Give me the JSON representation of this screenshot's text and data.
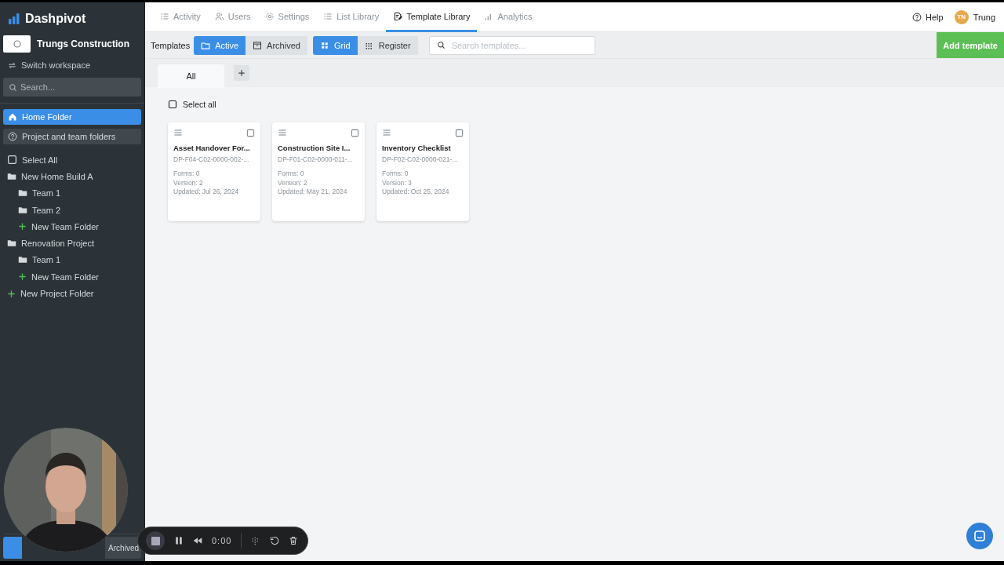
{
  "brand": {
    "name": "Dashpivot"
  },
  "workspace": {
    "name": "Trungs Construction",
    "switch_label": "Switch workspace"
  },
  "sidebar": {
    "search": {
      "placeholder": "Search..."
    },
    "nav": [
      {
        "label": "Home Folder",
        "selected": true
      },
      {
        "label": "Project and team folders",
        "selected": false
      }
    ],
    "tree": [
      {
        "kind": "checkbox",
        "label": "Select All",
        "checked": false
      },
      {
        "kind": "folder",
        "label": "New Home Build A",
        "children": [
          {
            "kind": "folder",
            "label": "Team 1"
          },
          {
            "kind": "folder",
            "label": "Team 2"
          },
          {
            "kind": "add",
            "label": "New Team Folder"
          }
        ]
      },
      {
        "kind": "folder",
        "label": "Renovation Project",
        "children": [
          {
            "kind": "folder",
            "label": "Team 1"
          },
          {
            "kind": "add",
            "label": "New Team Folder"
          }
        ]
      },
      {
        "kind": "add",
        "label": "New Project Folder"
      }
    ],
    "footer_button": {
      "label": "Archived"
    }
  },
  "top_nav": {
    "tabs": [
      {
        "label": "Activity",
        "selected": false
      },
      {
        "label": "Users",
        "selected": false
      },
      {
        "label": "Settings",
        "selected": false
      },
      {
        "label": "List Library",
        "selected": false
      },
      {
        "label": "Template Library",
        "selected": true
      },
      {
        "label": "Analytics",
        "selected": false
      }
    ],
    "help": "Help",
    "user": {
      "initials": "TN",
      "name": "Trung"
    }
  },
  "toolbar": {
    "label": "Templates",
    "status": [
      {
        "label": "Active",
        "selected": true
      },
      {
        "label": "Archived",
        "selected": false
      }
    ],
    "view": [
      {
        "label": "Grid",
        "selected": true
      },
      {
        "label": "Register",
        "selected": false
      }
    ],
    "search": {
      "placeholder": "Search templates..."
    },
    "add_button": "Add template"
  },
  "tabs": [
    {
      "label": "All",
      "selected": true
    }
  ],
  "select_all": {
    "label": "Select all",
    "checked": false
  },
  "cards": [
    {
      "title": "Asset Handover For...",
      "code": "DP-F04-C02-0000-002-...",
      "forms": "Forms: 0",
      "version": "Version: 2",
      "updated": "Updated: Jul 26, 2024",
      "checked": false
    },
    {
      "title": "Construction Site I...",
      "code": "DP-F01-C02-0000-011-...",
      "forms": "Forms: 0",
      "version": "Version: 2",
      "updated": "Updated: May 21, 2024",
      "checked": false
    },
    {
      "title": "Inventory Checklist",
      "code": "DP-F02-C02-0000-021-...",
      "forms": "Forms: 0",
      "version": "Version: 3",
      "updated": "Updated: Oct 25, 2024",
      "checked": false
    }
  ],
  "recorder": {
    "time": "0:00"
  }
}
